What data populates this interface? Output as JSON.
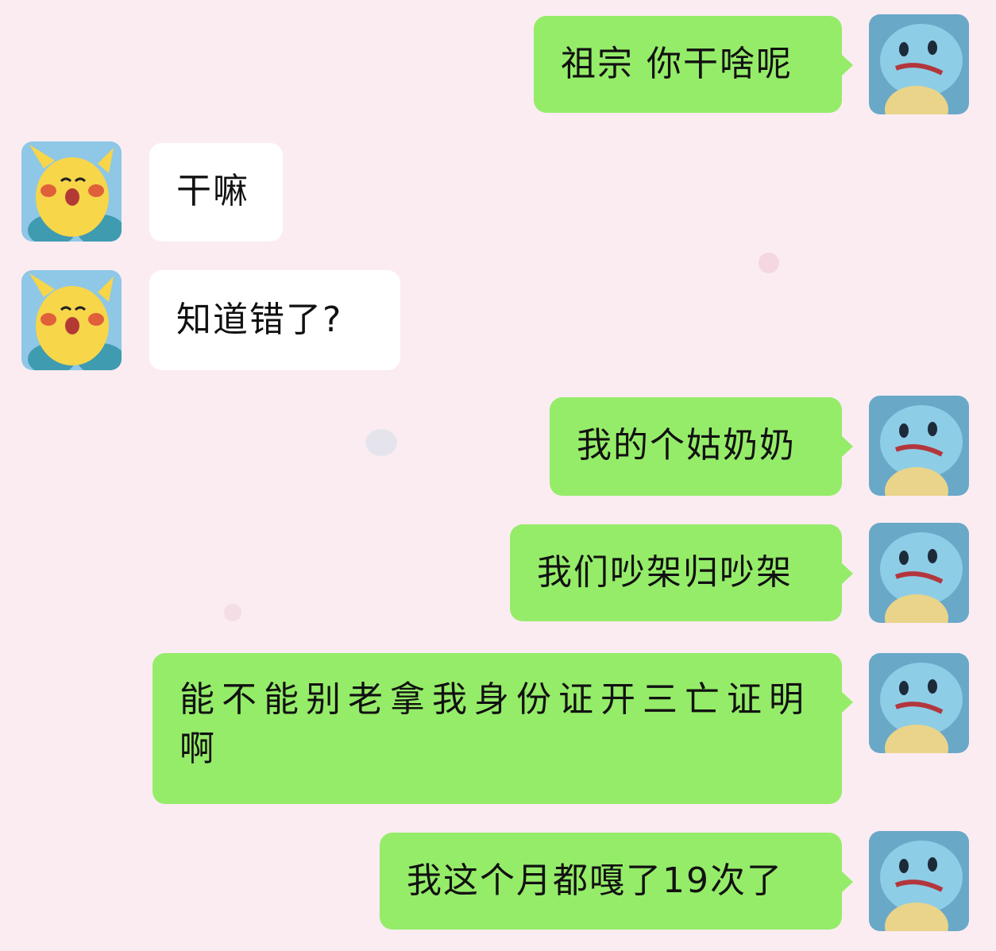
{
  "theme": {
    "background": "#fbecf1",
    "outgoing_bubble": "#95ec69",
    "incoming_bubble": "#ffffff"
  },
  "avatars": {
    "self": "squirtle-avatar",
    "other": "pikachu-avatar"
  },
  "messages": [
    {
      "side": "out",
      "text": "祖宗 你干啥呢"
    },
    {
      "side": "in",
      "text": "干嘛"
    },
    {
      "side": "in",
      "text": "知道错了?"
    },
    {
      "side": "out",
      "text": "我的个姑奶奶"
    },
    {
      "side": "out",
      "text": "我们吵架归吵架"
    },
    {
      "side": "out",
      "text": "能不能别老拿我身份证开三亡证明啊"
    },
    {
      "side": "out",
      "text": "我这个月都嘎了19次了"
    }
  ]
}
